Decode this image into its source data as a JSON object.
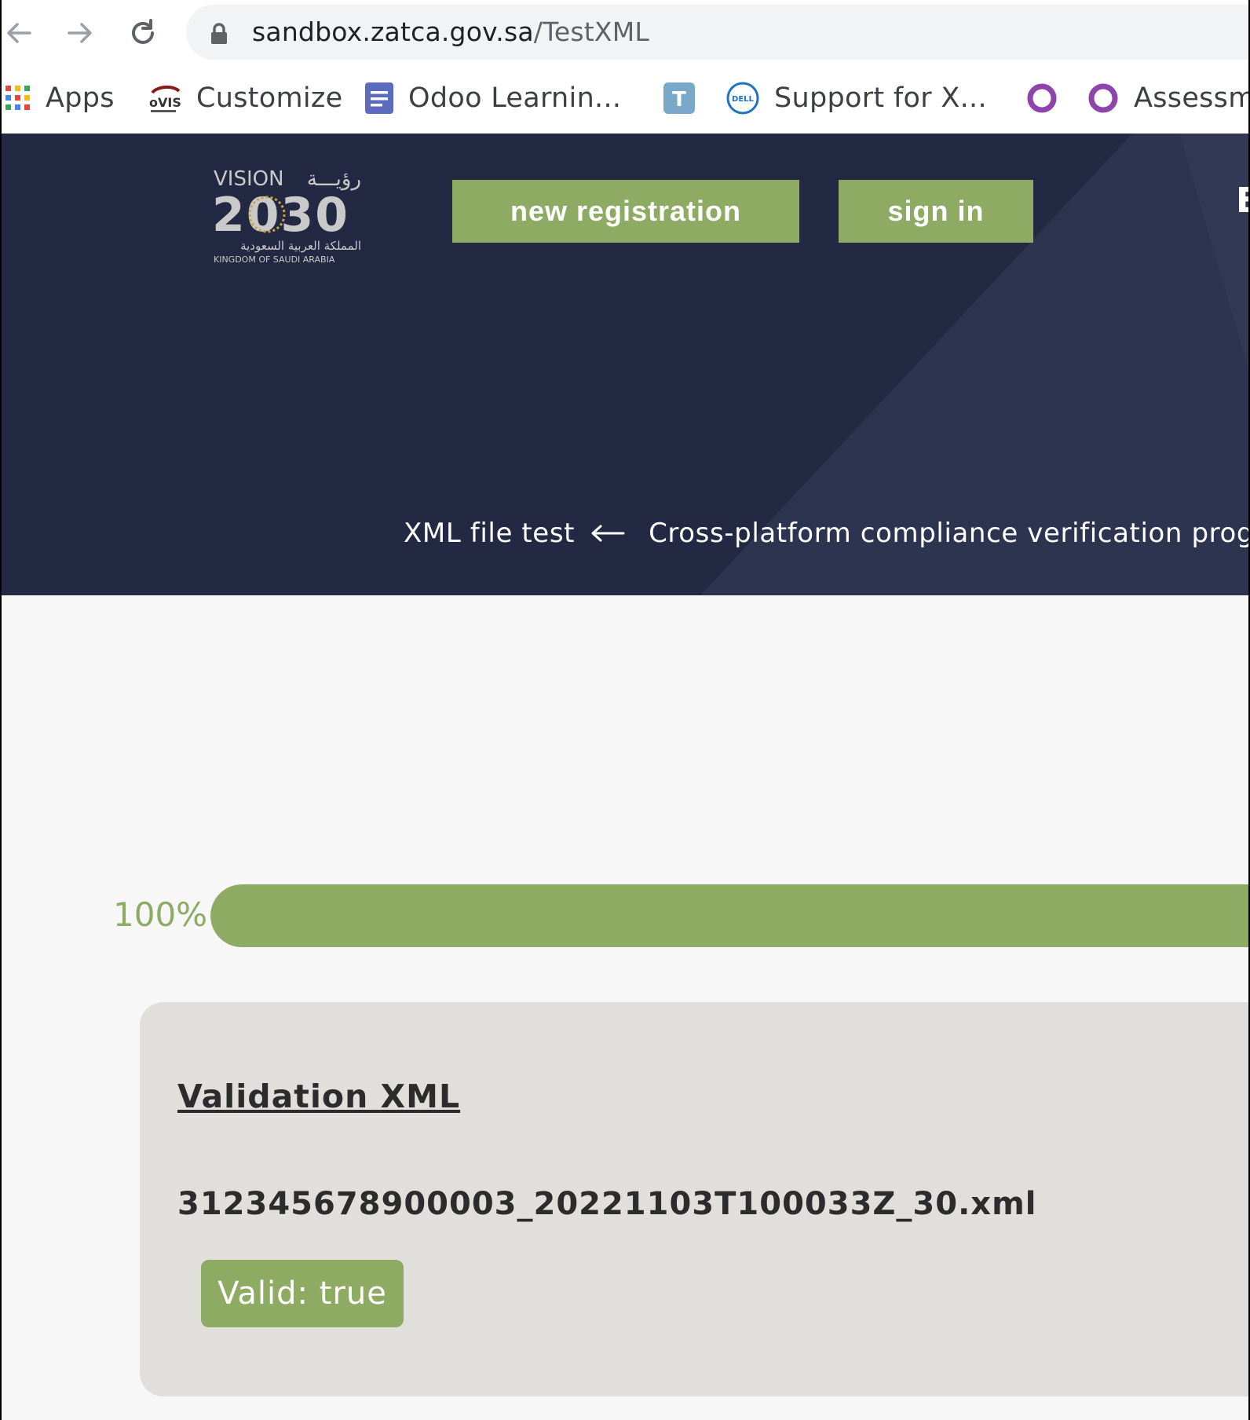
{
  "browser": {
    "url_host": "sandbox.zatca.gov.sa",
    "url_path": "/TestXML",
    "bookmarks": [
      {
        "label": "Apps",
        "icon": "apps-grid-icon"
      },
      {
        "label": "Customize",
        "icon": "ovis-eyecare-icon"
      },
      {
        "label": "Odoo Learnin...",
        "icon": "document-icon"
      },
      {
        "label": "",
        "icon": "t-badge-icon"
      },
      {
        "label": "Support for X...",
        "icon": "dell-logo-icon"
      },
      {
        "label": "",
        "icon": "circle-icon"
      },
      {
        "label": "Assessm",
        "icon": "circle-icon"
      }
    ]
  },
  "header": {
    "logo": {
      "line1": "VISION",
      "arabic1": "رؤيـــة",
      "year": "2030",
      "arabic2": "المملكة العربية السعودية",
      "line3": "KINGDOM OF SAUDI ARABIA"
    },
    "new_registration": "new registration",
    "sign_in": "sign in",
    "edge_letter": "E",
    "breadcrumb": {
      "current": "XML file test",
      "parent": "Cross-platform compliance verification progr"
    }
  },
  "progress": {
    "label": "100%",
    "value": 1.0
  },
  "result": {
    "title": "Validation XML",
    "file_name": "312345678900003_20221103T100033Z_30.xml",
    "status": "Valid: true"
  },
  "colors": {
    "accent_green": "#8eab64",
    "hero_navy": "#232943",
    "card_gray": "#e0dfdc"
  }
}
